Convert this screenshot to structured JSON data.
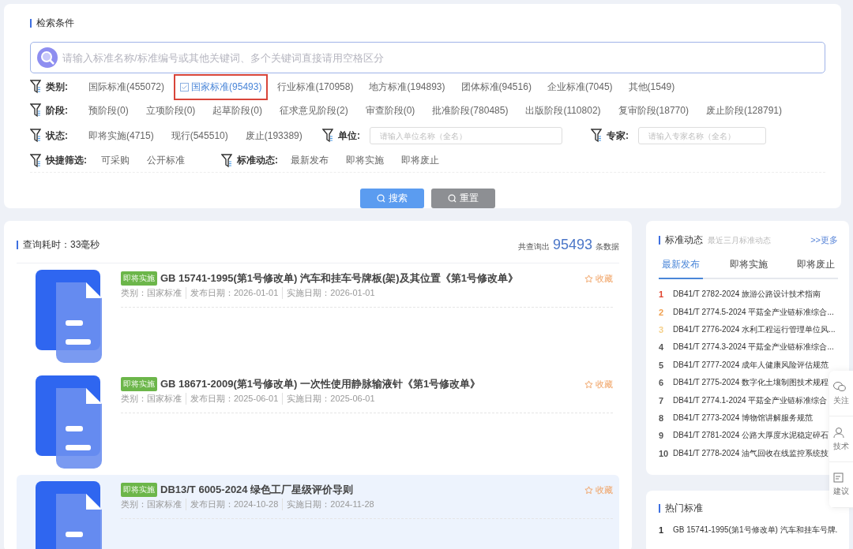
{
  "search_panel": {
    "title": "检索条件",
    "search": {
      "placeholder": "请输入标准名称/标准编号或其他关键词、多个关键词直接请用空格区分"
    },
    "filter_rows": [
      {
        "label": "类别:",
        "options": [
          {
            "text": "国际标准(455072)",
            "selected": false
          },
          {
            "text": "国家标准(95493)",
            "selected": true
          },
          {
            "text": "行业标准(170958)",
            "selected": false
          },
          {
            "text": "地方标准(194893)",
            "selected": false
          },
          {
            "text": "团体标准(94516)",
            "selected": false
          },
          {
            "text": "企业标准(7045)",
            "selected": false
          },
          {
            "text": "其他(1549)",
            "selected": false
          }
        ]
      },
      {
        "label": "阶段:",
        "options": [
          {
            "text": "预阶段(0)",
            "selected": false
          },
          {
            "text": "立项阶段(0)",
            "selected": false
          },
          {
            "text": "起草阶段(0)",
            "selected": false
          },
          {
            "text": "征求意见阶段(2)",
            "selected": false
          },
          {
            "text": "审查阶段(0)",
            "selected": false
          },
          {
            "text": "批准阶段(780485)",
            "selected": false
          },
          {
            "text": "出版阶段(110802)",
            "selected": false
          },
          {
            "text": "复审阶段(18770)",
            "selected": false
          },
          {
            "text": "废止阶段(128791)",
            "selected": false
          }
        ]
      }
    ],
    "status_row": {
      "label": "状态:",
      "options": [
        "即将实施(4715)",
        "现行(545510)",
        "废止(193389)"
      ],
      "unit": {
        "label": "单位:",
        "placeholder": "请输入单位名称（全名）"
      },
      "expert": {
        "label": "专家:",
        "placeholder": "请输入专家名称（全名）"
      }
    },
    "quick_row": {
      "label": "快捷筛选:",
      "options": [
        "可采购",
        "公开标准"
      ],
      "dynamics_label": "标准动态:",
      "dynamics_options": [
        "最新发布",
        "即将实施",
        "即将废止"
      ]
    },
    "buttons": [
      {
        "kind": "primary",
        "text": "搜索"
      },
      {
        "kind": "secondary",
        "text": "重置"
      }
    ]
  },
  "results": {
    "query_time": "查询耗时：33毫秒",
    "total_prefix": "共查询出",
    "total": "95493",
    "total_suffix": "条数据",
    "items": [
      {
        "tag": "即将实施",
        "title": "GB 15741-1995(第1号修改单)  汽车和挂车号牌板(架)及其位置《第1号修改单》",
        "category": "类别：国家标准",
        "published": "发布日期：2026-01-01",
        "implemented": "实施日期：2026-01-01",
        "favorite": "收藏",
        "selected": false
      },
      {
        "tag": "即将实施",
        "title": "GB 18671-2009(第1号修改单)  一次性使用静脉输液针《第1号修改单》",
        "category": "类别：国家标准",
        "published": "发布日期：2025-06-01",
        "implemented": "实施日期：2025-06-01",
        "favorite": "收藏",
        "selected": false
      },
      {
        "tag": "即将实施",
        "title": "DB13/T 6005-2024  绿色工厂星级评价导则",
        "category": "类别：国家标准",
        "published": "发布日期：2024-10-28",
        "implemented": "实施日期：2024-11-28",
        "favorite": "收藏",
        "selected": true
      }
    ]
  },
  "dynamics": {
    "title": "标准动态",
    "subtitle": "最近三月标准动态",
    "more": ">>更多",
    "tabs": [
      {
        "label": "最新发布",
        "selected": true
      },
      {
        "label": "即将实施",
        "selected": false
      },
      {
        "label": "即将废止",
        "selected": false
      }
    ],
    "items": [
      {
        "rank": "1",
        "color": "#e0442e",
        "text": "DB41/T 2782-2024 旅游公路设计技术指南"
      },
      {
        "rank": "2",
        "color": "#f0a050",
        "text": "DB41/T 2774.5-2024 平菇全产业链标准综合..."
      },
      {
        "rank": "3",
        "color": "#f5d08a",
        "text": "DB41/T 2776-2024 水利工程运行管理单位风..."
      },
      {
        "rank": "4",
        "color": "#555555",
        "text": "DB41/T 2774.3-2024 平菇全产业链标准综合..."
      },
      {
        "rank": "5",
        "color": "#555555",
        "text": "DB41/T 2777-2024 成年人健康风险评估规范"
      },
      {
        "rank": "6",
        "color": "#555555",
        "text": "DB41/T 2775-2024 数字化土壤制图技术规程"
      },
      {
        "rank": "7",
        "color": "#555555",
        "text": "DB41/T 2774.1-2024 平菇全产业链标准综合"
      },
      {
        "rank": "8",
        "color": "#555555",
        "text": "DB41/T 2773-2024 博物馆讲解服务规范"
      },
      {
        "rank": "9",
        "color": "#555555",
        "text": "DB41/T 2781-2024 公路大厚度水泥稳定碎石"
      },
      {
        "rank": "10",
        "color": "#555555",
        "text": "DB41/T 2778-2024 油气回收在线监控系统技"
      }
    ]
  },
  "hot": {
    "title": "热门标准",
    "items": [
      {
        "rank": "1",
        "text": "GB 15741-1995(第1号修改单) 汽车和挂车号牌."
      }
    ]
  },
  "float_bar": [
    {
      "kind": "wechat",
      "text": "关注"
    },
    {
      "kind": "support",
      "text": "技术"
    },
    {
      "kind": "feedback",
      "text": "建议"
    }
  ]
}
